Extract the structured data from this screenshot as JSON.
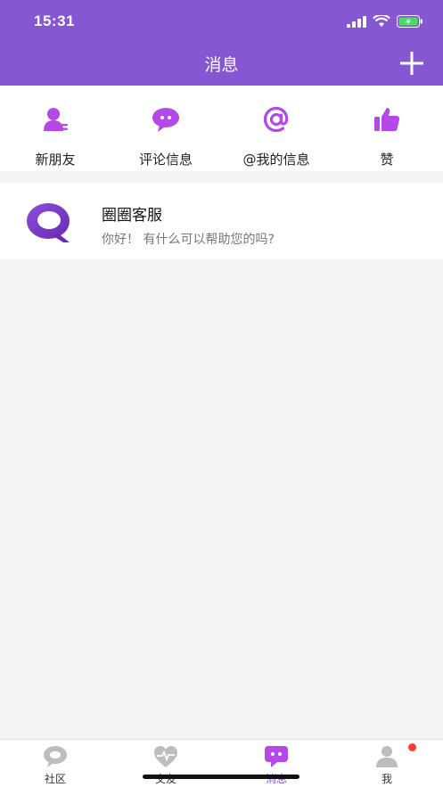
{
  "status_bar": {
    "time": "15:31"
  },
  "header": {
    "title": "消息",
    "add_icon": "plus-icon"
  },
  "colors": {
    "primary": "#8557d3",
    "icon_purple": "#b548e8",
    "background": "#f4f4f6",
    "badge_red": "#ff3b30"
  },
  "quick_actions": [
    {
      "label": "新朋友",
      "icon": "new-friend-icon"
    },
    {
      "label": "评论信息",
      "icon": "comment-icon"
    },
    {
      "label": "@我的信息",
      "icon": "at-icon"
    },
    {
      "label": "赞",
      "icon": "thumbs-up-icon"
    }
  ],
  "messages": [
    {
      "title": "圈圈客服",
      "preview": "你好！ 有什么可以帮助您的吗?",
      "avatar": "customer-service-logo"
    }
  ],
  "tabbar": [
    {
      "label": "社区",
      "icon": "community-icon"
    },
    {
      "label": "交友",
      "icon": "heartbeat-icon"
    },
    {
      "label": "消息",
      "icon": "message-icon",
      "active": true
    },
    {
      "label": "我",
      "icon": "profile-icon",
      "badge": true
    }
  ]
}
